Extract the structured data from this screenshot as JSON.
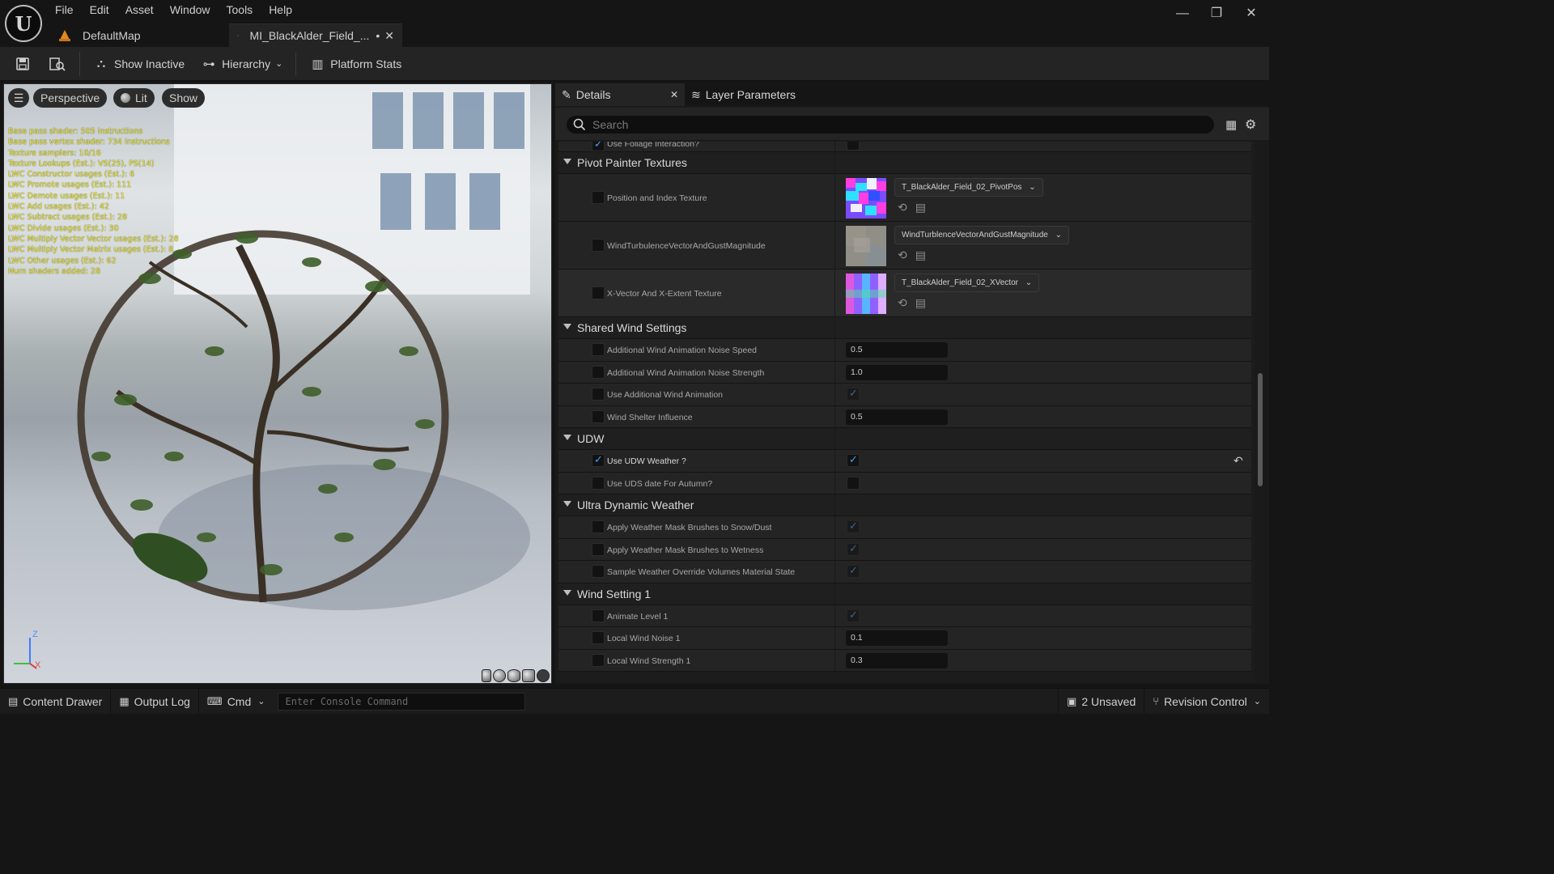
{
  "app": {
    "logo_letter": "U",
    "menu": [
      "File",
      "Edit",
      "Asset",
      "Window",
      "Tools",
      "Help"
    ],
    "window_controls": {
      "minimize": "—",
      "restore": "❐",
      "close": "✕"
    },
    "tabs": [
      {
        "label": "DefaultMap",
        "icon": "level-icon"
      },
      {
        "label": "MI_BlackAlder_Field_...",
        "dirty_marker": "•",
        "icon": "material-instance-icon"
      }
    ]
  },
  "toolbar": {
    "show_inactive": "Show Inactive",
    "hierarchy": "Hierarchy",
    "platform_stats": "Platform Stats"
  },
  "viewport": {
    "perspective": "Perspective",
    "lit": "Lit",
    "show": "Show",
    "axis": {
      "z": "Z",
      "x": "X"
    },
    "stats": [
      "Base pass shader: 505 instructions",
      "Base pass vertex shader: 734 instructions",
      "Texture samplers: 10/16",
      "Texture Lookups (Est.): VS(25), PS(14)",
      "LWC Constructor usages (Est.): 6",
      "LWC Promote usages (Est.): 111",
      "LWC Demote usages (Est.): 11",
      "LWC Add usages (Est.): 42",
      "LWC Subtract usages (Est.): 28",
      "LWC Divide usages (Est.): 30",
      "LWC Multiply Vector Vector usages (Est.): 28",
      "LWC Multiply Vector Matrix usages (Est.): 8",
      "LWC Other usages (Est.): 62",
      "Num shaders added: 28"
    ]
  },
  "details": {
    "tab_details": "Details",
    "tab_layers": "Layer Parameters",
    "search_placeholder": "Search",
    "partial_row": "Use Foliage Interaction?",
    "pivot": {
      "title": "Pivot Painter Textures",
      "rows": [
        {
          "label": "Position and Index Texture",
          "asset": "T_BlackAlder_Field_02_PivotPos"
        },
        {
          "label": "WindTurbulenceVectorAndGustMagnitude",
          "asset": "WindTurblenceVectorAndGustMagnitude"
        },
        {
          "label": "X-Vector And X-Extent Texture",
          "asset": "T_BlackAlder_Field_02_XVector"
        }
      ]
    },
    "shared_wind": {
      "title": "Shared Wind Settings",
      "rows": [
        {
          "label": "Additional Wind Animation Noise Speed",
          "value": "0.5"
        },
        {
          "label": "Additional Wind Animation Noise Strength",
          "value": "1.0"
        },
        {
          "label": "Use Additional Wind Animation",
          "checked": true
        },
        {
          "label": "Wind Shelter Influence",
          "value": "0.5"
        }
      ]
    },
    "udw": {
      "title": "UDW",
      "rows": [
        {
          "label": "Use UDW Weather ?",
          "checked": true,
          "override": true
        },
        {
          "label": "Use UDS date For Autumn?",
          "checked": false
        }
      ]
    },
    "ultra_dynamic": {
      "title": "Ultra Dynamic Weather",
      "rows": [
        {
          "label": "Apply Weather Mask Brushes to Snow/Dust",
          "checked": true
        },
        {
          "label": "Apply Weather Mask Brushes to Wetness",
          "checked": true
        },
        {
          "label": "Sample Weather Override Volumes Material State",
          "checked": true
        }
      ]
    },
    "wind1": {
      "title": "Wind Setting 1",
      "rows": [
        {
          "label": "Animate Level 1",
          "checked": true
        },
        {
          "label": "Local Wind Noise 1",
          "value": "0.1"
        },
        {
          "label": "Local Wind Strength 1",
          "value": "0.3"
        }
      ]
    }
  },
  "bottom": {
    "content_drawer": "Content Drawer",
    "output_log": "Output Log",
    "cmd": "Cmd",
    "console_placeholder": "Enter Console Command",
    "unsaved": "2 Unsaved",
    "revision": "Revision Control"
  },
  "colors": {
    "accent": "#4a9bff",
    "stats_text": "#f0ea2a",
    "panel": "#242424"
  }
}
